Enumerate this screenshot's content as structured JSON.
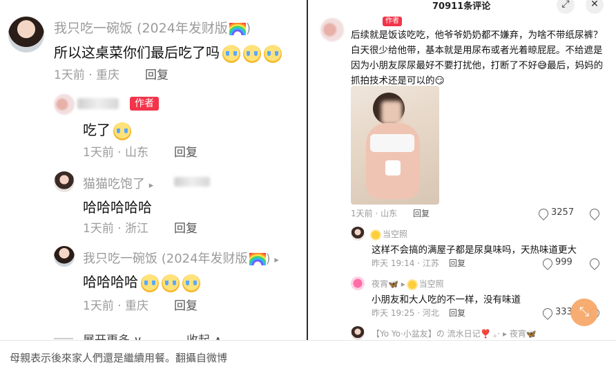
{
  "left_panel": {
    "comments": [
      {
        "username": "我只吃一碗饭 (2024年发财版",
        "text": "所以这桌菜你们最后吃了吗",
        "time_location": "1天前 · 重庆",
        "reply_label": "回复"
      },
      {
        "author_badge": "作者",
        "text": "吃了",
        "time_location": "1天前 · 山东",
        "reply_label": "回复"
      },
      {
        "username": "猫猫吃饱了",
        "arrow": "▸",
        "text": "哈哈哈哈哈",
        "time_location": "1天前 · 浙江",
        "reply_label": "回复"
      },
      {
        "username": "我只吃一碗饭 (2024年发财版",
        "arrow": "▸",
        "text": "哈哈哈哈",
        "time_location": "1天前 · 重庆",
        "reply_label": "回复"
      }
    ],
    "footer": {
      "expand_label": "展开更多",
      "collapse_label": "收起"
    }
  },
  "right_panel": {
    "title": "70911条评论",
    "author_badge": "作者",
    "post_text": "后续就是饭该吃吃，他爷爷奶奶都不嫌弃，为啥不带纸尿裤？白天很少给他带，基本就是用尿布或者光着晾屁屁。不给遮是因为小朋友尿尿最好不要打扰他，打断了不好😅最后，妈妈的抓拍技术还是可以的😏",
    "post_meta": "1天前 · 山东",
    "post_reply": "回复",
    "post_likes": "3257",
    "replies": [
      {
        "username": "当空照",
        "text": "这样不会搞的满屋子都是尿臭味吗，天热味道更大",
        "meta": "昨天 19:14 · 江苏",
        "reply_label": "回复",
        "likes": "999"
      },
      {
        "username": "夜宵🦋",
        "to_user": "当空照",
        "text": "小朋友和大人吃的不一样，没有味道",
        "meta": "昨天 19:25 · 河北",
        "reply_label": "回复",
        "likes": "333"
      },
      {
        "username": "【Yo Yo·小盆友】の 流水日记❣️ 。·",
        "to_user": "夜宵🦋"
      }
    ]
  },
  "caption": "母親表示後來家人們還是繼續用餐。翻攝自微博",
  "icons": {
    "close": "close-icon",
    "expand": "expand-icon",
    "heart": "heart-icon",
    "dislike": "dislike-icon"
  },
  "colors": {
    "author_badge": "#f2354a",
    "fab": "#f7a96a"
  }
}
